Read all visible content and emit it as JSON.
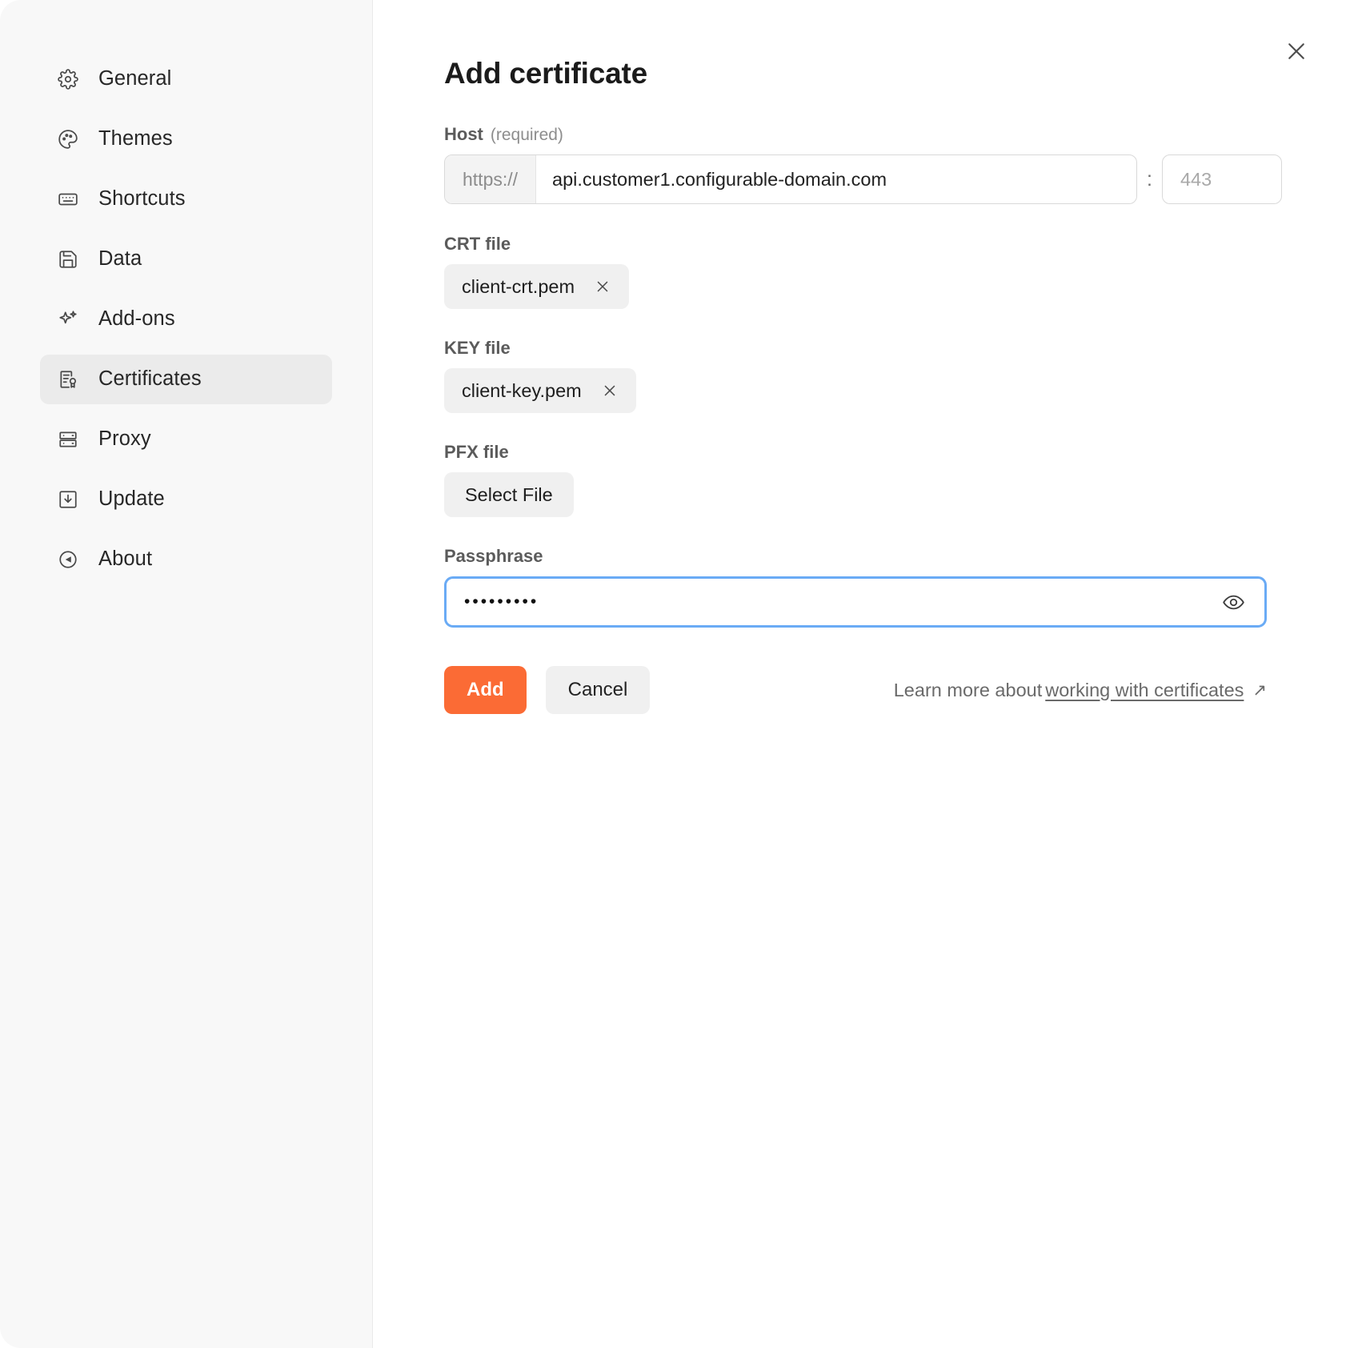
{
  "sidebar": {
    "items": [
      {
        "label": "General",
        "icon": "gear-icon",
        "active": false
      },
      {
        "label": "Themes",
        "icon": "palette-icon",
        "active": false
      },
      {
        "label": "Shortcuts",
        "icon": "keyboard-icon",
        "active": false
      },
      {
        "label": "Data",
        "icon": "floppy-disk-icon",
        "active": false
      },
      {
        "label": "Add-ons",
        "icon": "sparkles-icon",
        "active": false
      },
      {
        "label": "Certificates",
        "icon": "certificate-icon",
        "active": true
      },
      {
        "label": "Proxy",
        "icon": "server-icon",
        "active": false
      },
      {
        "label": "Update",
        "icon": "download-icon",
        "active": false
      },
      {
        "label": "About",
        "icon": "info-circle-icon",
        "active": false
      }
    ]
  },
  "main": {
    "title": "Add certificate",
    "close_icon": "close-icon",
    "host": {
      "label": "Host",
      "required_note": "(required)",
      "protocol_prefix": "https://",
      "value": "api.customer1.configurable-domain.com",
      "placeholder": "",
      "separator": ":",
      "port_value": "",
      "port_placeholder": "443"
    },
    "crt": {
      "label": "CRT file",
      "file_name": "client-crt.pem",
      "remove_icon": "close-icon"
    },
    "key": {
      "label": "KEY file",
      "file_name": "client-key.pem",
      "remove_icon": "close-icon"
    },
    "pfx": {
      "label": "PFX file",
      "select_button": "Select File"
    },
    "passphrase": {
      "label": "Passphrase",
      "value": "•••••••••",
      "placeholder": "",
      "reveal_icon": "eye-icon",
      "focused": true
    },
    "actions": {
      "add_label": "Add",
      "cancel_label": "Cancel"
    },
    "learn_more": {
      "prefix": "Learn more about",
      "link_text": "working with certificates",
      "external_icon": "↗"
    }
  },
  "colors": {
    "accent": "#fb6b35",
    "focus_border": "#6aabf5",
    "sidebar_bg": "#f8f8f8",
    "active_item_bg": "#ebebeb",
    "chip_bg": "#f0f0f0"
  }
}
